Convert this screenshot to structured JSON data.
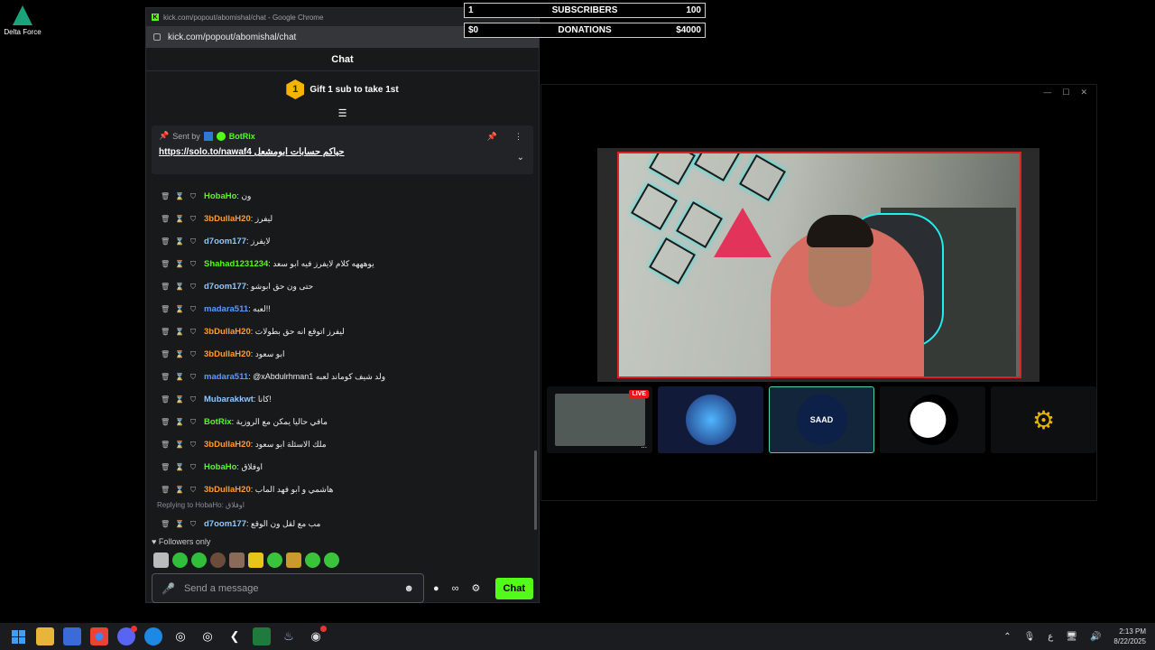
{
  "desktop": {
    "icon_label": "Delta Force"
  },
  "overlay": {
    "subscribers": {
      "left": "1",
      "label": "SUBSCRIBERS",
      "right": "100"
    },
    "donations": {
      "left": "$0",
      "label": "DONATIONS",
      "right": "$4000"
    }
  },
  "chrome": {
    "title": "kick.com/popout/abomishal/chat - Google Chrome",
    "url": "kick.com/popout/abomishal/chat"
  },
  "chat": {
    "header": "Chat",
    "gift_badge": "1",
    "gift_text": "Gift 1 sub to take 1st",
    "pinned": {
      "sent_by": "Sent by",
      "bot_name": "BotRix",
      "message": "https://solo.to/nawaf4 حياكم حسابات ابومشعل"
    },
    "messages": [
      {
        "user": "HobaHo",
        "color": "green",
        "text": "ون"
      },
      {
        "user": "3bDullaH20",
        "color": "orange",
        "text": "ليفرز"
      },
      {
        "user": "d7oom177",
        "color": "sky",
        "text": "لايفرز"
      },
      {
        "user": "Shahad1231234",
        "color": "green",
        "text": "يوهههه كلام لايفرز فيه ابو سعد"
      },
      {
        "user": "d7oom177",
        "color": "sky",
        "text": "حتى ون حق ابوشو"
      },
      {
        "user": "madara511",
        "color": "blue",
        "text": "لعبه!!"
      },
      {
        "user": "3bDullaH20",
        "color": "orange",
        "text": "ليفرز اتوقع انه حق بطولات"
      },
      {
        "user": "3bDullaH20",
        "color": "orange",
        "text": "ابو سعود"
      },
      {
        "user": "madara511",
        "color": "blue",
        "text": "@xAbdulrhman1 ولد شيف كوماند لعبه"
      },
      {
        "user": "Mubarakkwt",
        "color": "sky",
        "text": "كانا!"
      },
      {
        "user": "BotRix",
        "color": "green",
        "text": "مافي حاليا يمكن مع الروزية"
      },
      {
        "user": "3bDullaH20",
        "color": "orange",
        "text": "ملك الاسئلة ابو سعود"
      },
      {
        "user": "HobaHo",
        "color": "green",
        "text": "اوفلاق"
      },
      {
        "user": "3bDullaH20",
        "color": "orange",
        "text": "هاشمي و ابو فهد الماب"
      }
    ],
    "reply_to": "Replying to HobaHo: اوفلاق",
    "reply_message": {
      "user": "d7oom177",
      "text": "مب مع لقل ون الوقع"
    },
    "followers_only": "Followers only",
    "input_placeholder": "Send a message",
    "infinity": "∞",
    "send_button": "Chat"
  },
  "sources": {
    "live_badge": "LIVE",
    "more": "...",
    "saad_label": "SAAD"
  },
  "taskbar": {
    "time": "2:13 PM",
    "date": "8/22/2025",
    "lang": "ع"
  }
}
